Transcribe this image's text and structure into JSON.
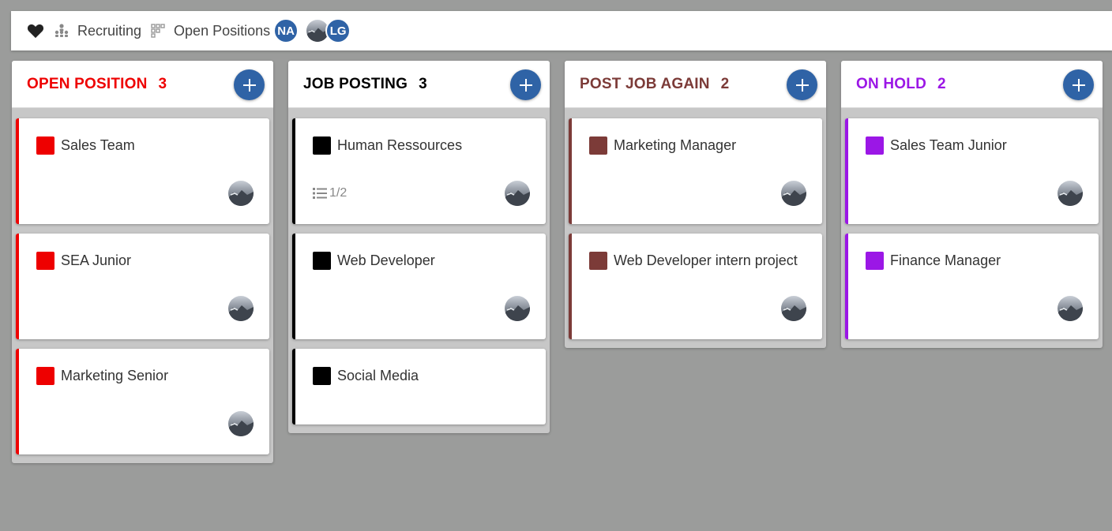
{
  "topbar": {
    "heart_icon": "heart-icon",
    "org_icon": "org-chart-icon",
    "project_label": "Recruiting",
    "grid_icon": "grid-icon",
    "stage_label": "Open Positions",
    "avatars": [
      {
        "initials": "NA",
        "color": "#2f63a6"
      },
      {
        "initials": "",
        "photo": true
      },
      {
        "initials": "LG",
        "color": "#2f63a6"
      }
    ]
  },
  "columns": [
    {
      "title": "OPEN POSITION",
      "count": "3",
      "color": "#ee0000",
      "cards": [
        {
          "title": "Sales Team"
        },
        {
          "title": "SEA Junior"
        },
        {
          "title": "Marketing Senior"
        }
      ]
    },
    {
      "title": "JOB POSTING",
      "count": "3",
      "color": "#000000",
      "cards": [
        {
          "title": "Human Ressources",
          "checklist": "1/2"
        },
        {
          "title": "Web Developer"
        },
        {
          "title": "Social Media"
        }
      ]
    },
    {
      "title": "POST JOB AGAIN",
      "count": "2",
      "color": "#7c3b38",
      "cards": [
        {
          "title": "Marketing Manager"
        },
        {
          "title": "Web Developer intern project"
        }
      ]
    },
    {
      "title": "ON HOLD",
      "count": "2",
      "color": "#9b17e6",
      "cards": [
        {
          "title": "Sales Team Junior"
        },
        {
          "title": "Finance Manager"
        }
      ]
    }
  ],
  "add_button_color": "#2f63a6"
}
